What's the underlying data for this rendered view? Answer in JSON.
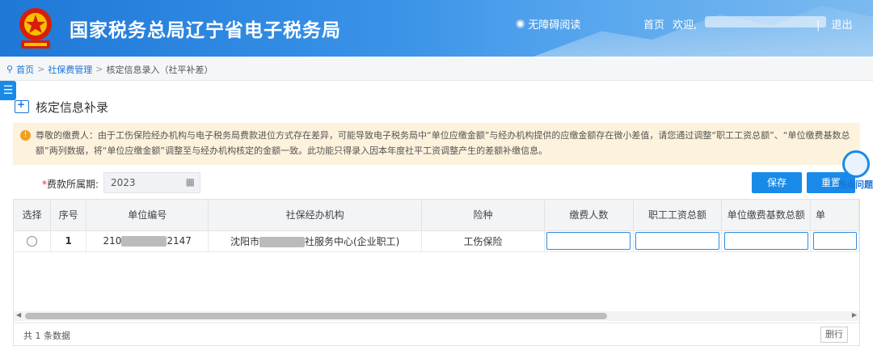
{
  "header": {
    "title": "国家税务总局辽宁省电子税务局",
    "accessibility": "无障碍阅读",
    "nav_home": "首页",
    "welcome": "欢迎,",
    "logout": "退出",
    "separator": "|"
  },
  "breadcrumb": {
    "home": "首页",
    "section": "社保费管理",
    "current": "核定信息录入（社平补差）",
    "sep": ">"
  },
  "page": {
    "title": "核定信息补录",
    "notice": "尊敬的缴费人：由于工伤保险经办机构与电子税务局费款进位方式存在差异，可能导致电子税务局中“单位应缴金额”与经办机构提供的应缴金额存在微小差值，请您通过调整“职工工资总额”、“单位缴费基数总额”两列数据，将“单位应缴金额”调整至与经办机构核定的金额一致。此功能只得录入因本年度社平工资调整产生的差额补缴信息。"
  },
  "form": {
    "period_required": "*",
    "period_label": "费款所属期:",
    "period_value": "2023",
    "save": "保存",
    "reset": "重置",
    "help": "热点问题"
  },
  "table": {
    "columns": [
      "选择",
      "序号",
      "单位编号",
      "社保经办机构",
      "险种",
      "缴费人数",
      "职工工资总额",
      "单位缴费基数总额",
      "单"
    ],
    "rows": [
      {
        "index": "1",
        "unit_code_prefix": "210",
        "unit_code_suffix": "2147",
        "agency_prefix": "沈阳市",
        "agency_suffix": "社服务中心(企业职工)",
        "insurance": "工伤保险"
      }
    ],
    "footer_count": "共 1 条数据",
    "delete_row": "删行"
  },
  "colors": {
    "header_blue": "#1f78d6",
    "primary_button": "#1a8ae8",
    "notice_bg": "#fdf2dc"
  }
}
